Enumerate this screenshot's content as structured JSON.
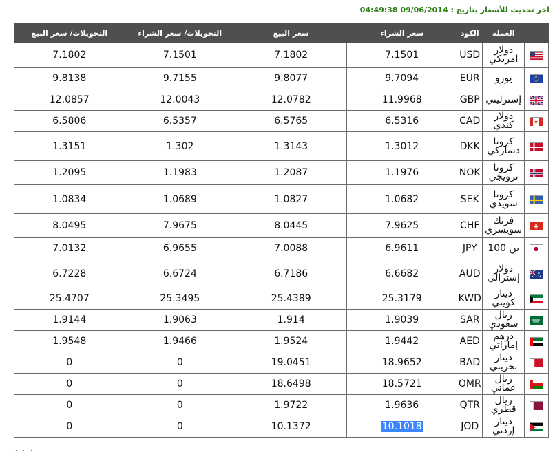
{
  "update_line": "آخر تحديث للأسعار بتاريخ : 09/06/2014 04:49:38",
  "headers": {
    "flag": "",
    "currency": "العملة",
    "code": "الكود",
    "buy": "سعر الشراء",
    "sell": "سعر البيع",
    "transfer_buy": "التحويلات/ سعر الشراء",
    "transfer_sell": "التحويلات/ سعر البيع"
  },
  "rows": [
    {
      "icon": "us-flag-icon",
      "name": "دولار امريكي",
      "code": "USD",
      "buy": "7.1501",
      "sell": "7.1802",
      "tbuy": "7.1501",
      "tsell": "7.1802",
      "h": 37
    },
    {
      "icon": "eu-flag-icon",
      "name": "يورو",
      "code": "EUR",
      "buy": "9.7094",
      "sell": "9.8077",
      "tbuy": "9.7155",
      "tsell": "9.8138",
      "h": 31
    },
    {
      "icon": "uk-flag-icon",
      "name": "إسترليني",
      "code": "GBP",
      "buy": "11.9968",
      "sell": "12.0782",
      "tbuy": "12.0043",
      "tsell": "12.0857",
      "h": 31
    },
    {
      "icon": "ca-flag-icon",
      "name": "دولار كندي",
      "code": "CAD",
      "buy": "6.5316",
      "sell": "6.5765",
      "tbuy": "6.5357",
      "tsell": "6.5806",
      "h": 31
    },
    {
      "icon": "dk-flag-icon",
      "name": "كرونا دنماركي",
      "code": "DKK",
      "buy": "1.3012",
      "sell": "1.3143",
      "tbuy": "1.302",
      "tsell": "1.3151",
      "h": 42
    },
    {
      "icon": "no-flag-icon",
      "name": "كرونا نرويجي",
      "code": "NOK",
      "buy": "1.1976",
      "sell": "1.2087",
      "tbuy": "1.1983",
      "tsell": "1.2095",
      "h": 35
    },
    {
      "icon": "se-flag-icon",
      "name": "كرونا سويدي",
      "code": "SEK",
      "buy": "1.0682",
      "sell": "1.0827",
      "tbuy": "1.0689",
      "tsell": "1.0834",
      "h": 42
    },
    {
      "icon": "ch-flag-icon",
      "name": "فرنك سويسري",
      "code": "CHF",
      "buy": "7.9625",
      "sell": "8.0445",
      "tbuy": "7.9675",
      "tsell": "8.0495",
      "h": 35
    },
    {
      "icon": "jp-flag-icon",
      "name": "ين 100",
      "code": "JPY",
      "buy": "6.9611",
      "sell": "7.0088",
      "tbuy": "6.9655",
      "tsell": "7.0132",
      "h": 31
    },
    {
      "icon": "au-flag-icon",
      "name": "دولار إسترالي",
      "code": "AUD",
      "buy": "6.6682",
      "sell": "6.7186",
      "tbuy": "6.6724",
      "tsell": "6.7228",
      "h": 42
    },
    {
      "icon": "kw-flag-icon",
      "name": "دينار كويتي",
      "code": "KWD",
      "buy": "25.3179",
      "sell": "25.4389",
      "tbuy": "25.3495",
      "tsell": "25.4707",
      "h": 31
    },
    {
      "icon": "sa-flag-icon",
      "name": "ريال سعودي",
      "code": "SAR",
      "buy": "1.9039",
      "sell": "1.914",
      "tbuy": "1.9063",
      "tsell": "1.9144",
      "h": 31
    },
    {
      "icon": "ae-flag-icon",
      "name": "درهم إماراتي",
      "code": "AED",
      "buy": "1.9442",
      "sell": "1.9524",
      "tbuy": "1.9466",
      "tsell": "1.9548",
      "h": 31
    },
    {
      "icon": "bh-flag-icon",
      "name": "دينار بحريني",
      "code": "BAD",
      "buy": "18.9652",
      "sell": "19.0451",
      "tbuy": "0",
      "tsell": "0",
      "h": 31
    },
    {
      "icon": "om-flag-icon",
      "name": "ريال عماني",
      "code": "OMR",
      "buy": "18.5721",
      "sell": "18.6498",
      "tbuy": "0",
      "tsell": "0",
      "h": 31
    },
    {
      "icon": "qa-flag-icon",
      "name": "ريال قطري",
      "code": "QTR",
      "buy": "1.9636",
      "sell": "1.9722",
      "tbuy": "0",
      "tsell": "0",
      "h": 31
    },
    {
      "icon": "jo-flag-icon",
      "name": "دينار إردني",
      "code": "JOD",
      "buy": "10.1018",
      "sell": "10.1372",
      "tbuy": "0",
      "tsell": "0",
      "h": 31,
      "selected": true
    }
  ]
}
